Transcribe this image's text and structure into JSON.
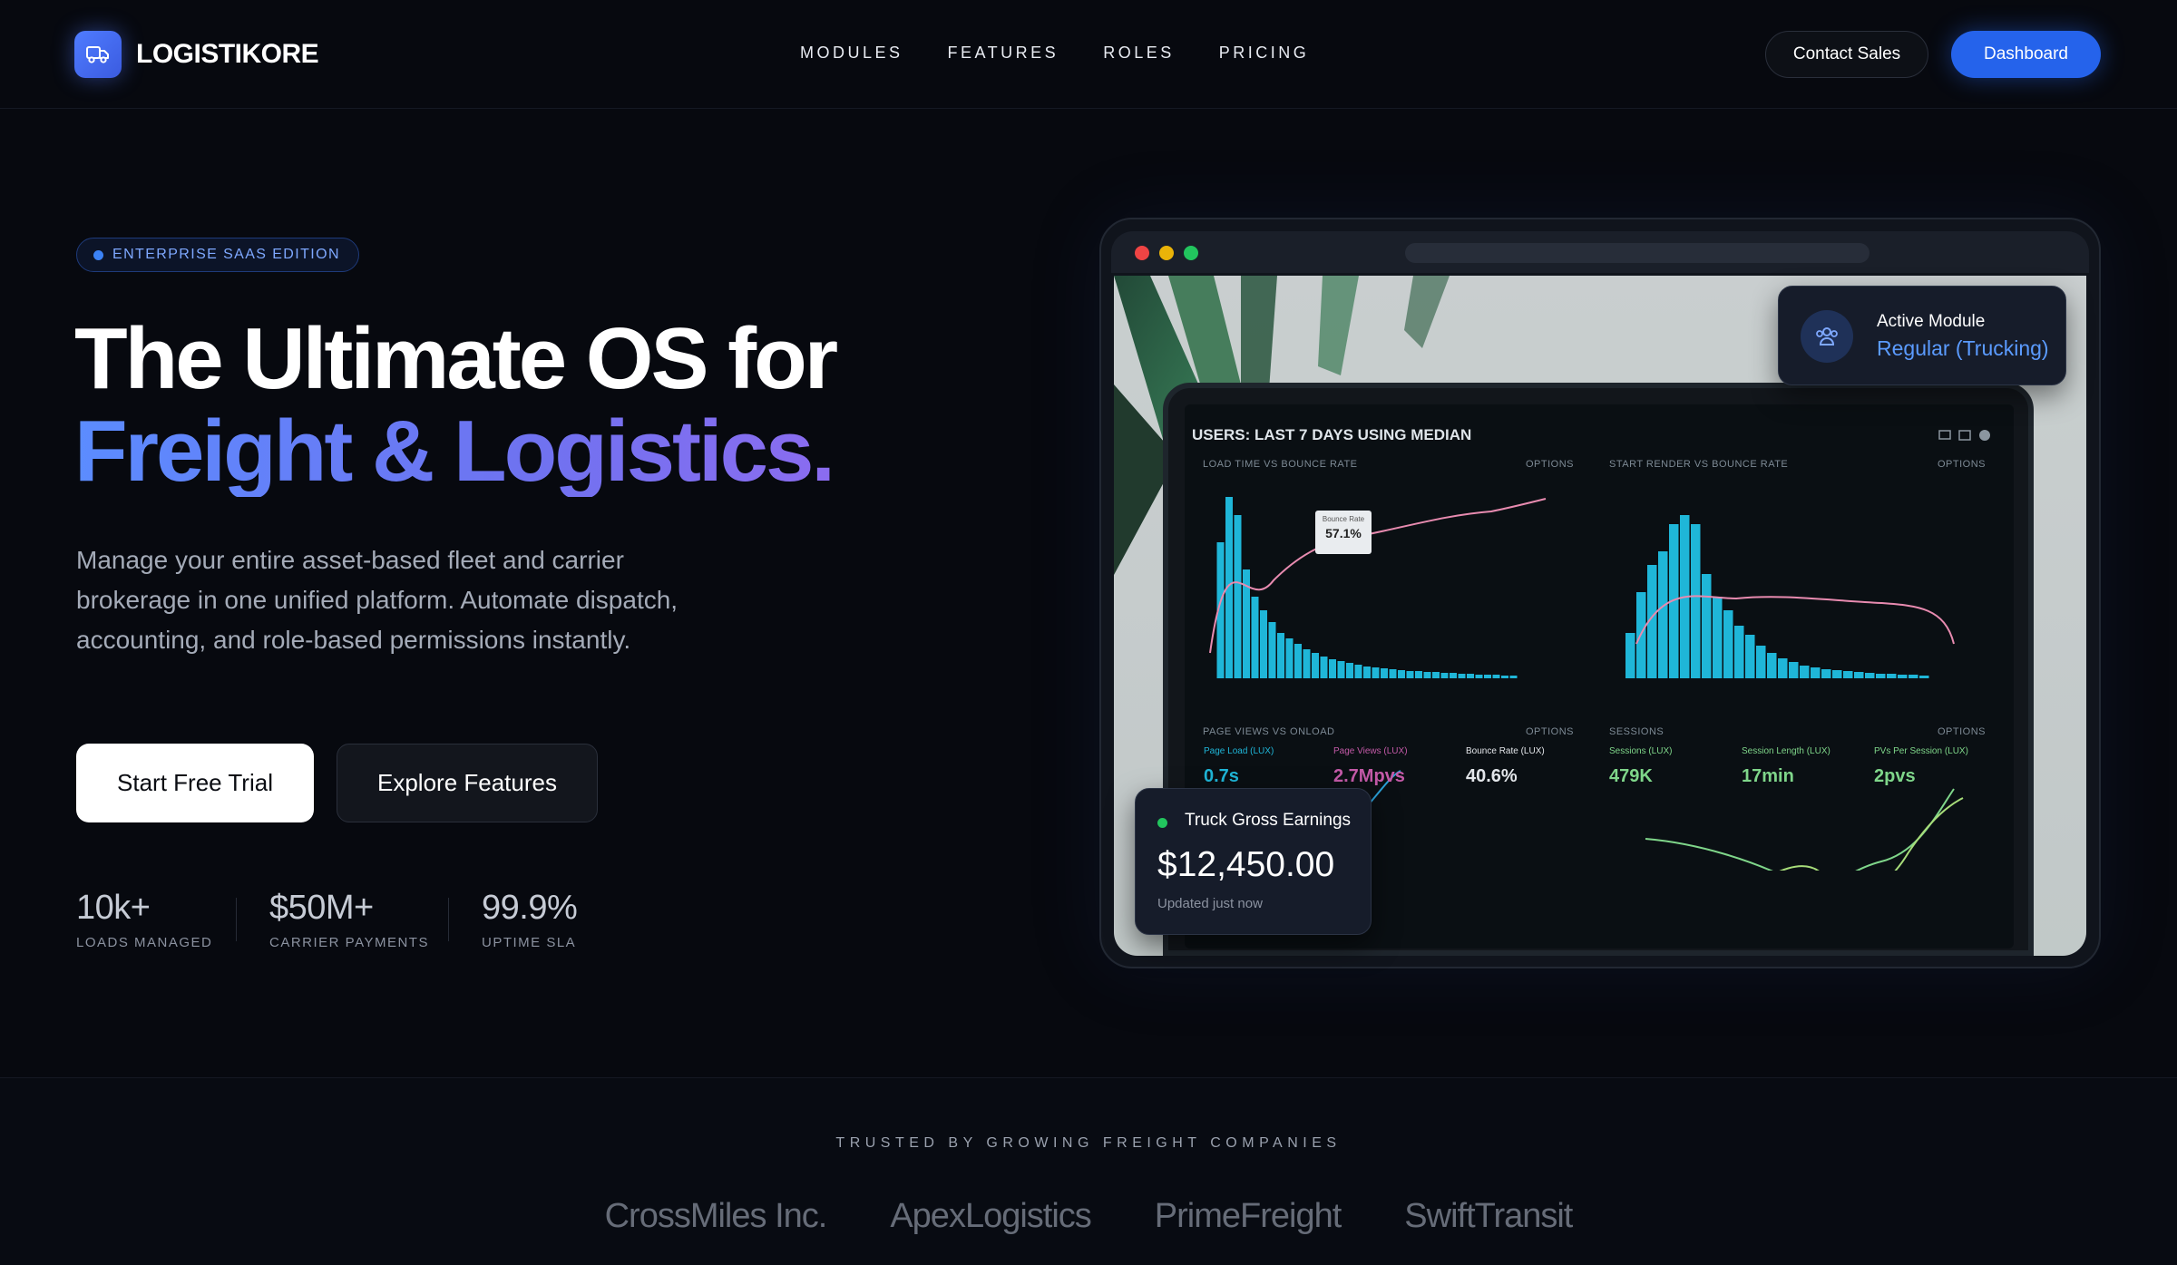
{
  "nav": {
    "brand": "LOGISTIKORE",
    "links": [
      "MODULES",
      "FEATURES",
      "ROLES",
      "PRICING"
    ],
    "contact_label": "Contact Sales",
    "dashboard_label": "Dashboard"
  },
  "hero": {
    "badge": "ENTERPRISE SAAS EDITION",
    "title_line1": "The Ultimate OS for",
    "title_line2": "Freight & Logistics.",
    "lead": "Manage your entire asset-based fleet and carrier brokerage in one unified platform. Automate dispatch, accounting, and role-based permissions instantly.",
    "cta_primary": "Start Free Trial",
    "cta_secondary": "Explore Features",
    "stats": [
      {
        "value": "10k+",
        "label": "LOADS MANAGED"
      },
      {
        "value": "$50M+",
        "label": "CARRIER PAYMENTS"
      },
      {
        "value": "99.9%",
        "label": "UPTIME SLA"
      }
    ]
  },
  "mockup": {
    "dashboard_title": "USERS: LAST 7 DAYS USING MEDIAN",
    "panel1_title": "LOAD TIME VS BOUNCE RATE",
    "panel2_title": "START RENDER VS BOUNCE RATE",
    "panel3_title": "PAGE VIEWS VS ONLOAD",
    "panel4_title": "SESSIONS",
    "options": "OPTIONS",
    "tooltip_label": "Bounce Rate",
    "tooltip_value": "57.1%",
    "kpis": [
      {
        "label": "Page Load (LUX)",
        "value": "0.7s",
        "color": "#1fb6d8"
      },
      {
        "label": "Page Views (LUX)",
        "value": "2.7Mpvs",
        "color": "#c45aa8"
      },
      {
        "label": "Bounce Rate (LUX)",
        "value": "40.6%",
        "color": "#e3e6ea"
      },
      {
        "label": "Sessions (LUX)",
        "value": "479K",
        "color": "#7fd68a"
      },
      {
        "label": "Session Length (LUX)",
        "value": "17min",
        "color": "#7fd68a"
      },
      {
        "label": "PVs Per Session (LUX)",
        "value": "2pvs",
        "color": "#7fd68a"
      }
    ]
  },
  "module_card": {
    "title": "Active Module",
    "value": "Regular (Trucking)"
  },
  "earnings_card": {
    "title": "Truck Gross Earnings",
    "value": "$12,450.00",
    "updated": "Updated just now"
  },
  "trust": {
    "heading": "TRUSTED BY GROWING FREIGHT COMPANIES",
    "companies": [
      "CrossMiles Inc.",
      "ApexLogistics",
      "PrimeFreight",
      "SwiftTransit"
    ]
  },
  "colors": {
    "accent": "#2563eb",
    "gradient_start": "#5b8cff",
    "gradient_end": "#8b6cf0",
    "chart_bars": "#1fb6d8"
  }
}
